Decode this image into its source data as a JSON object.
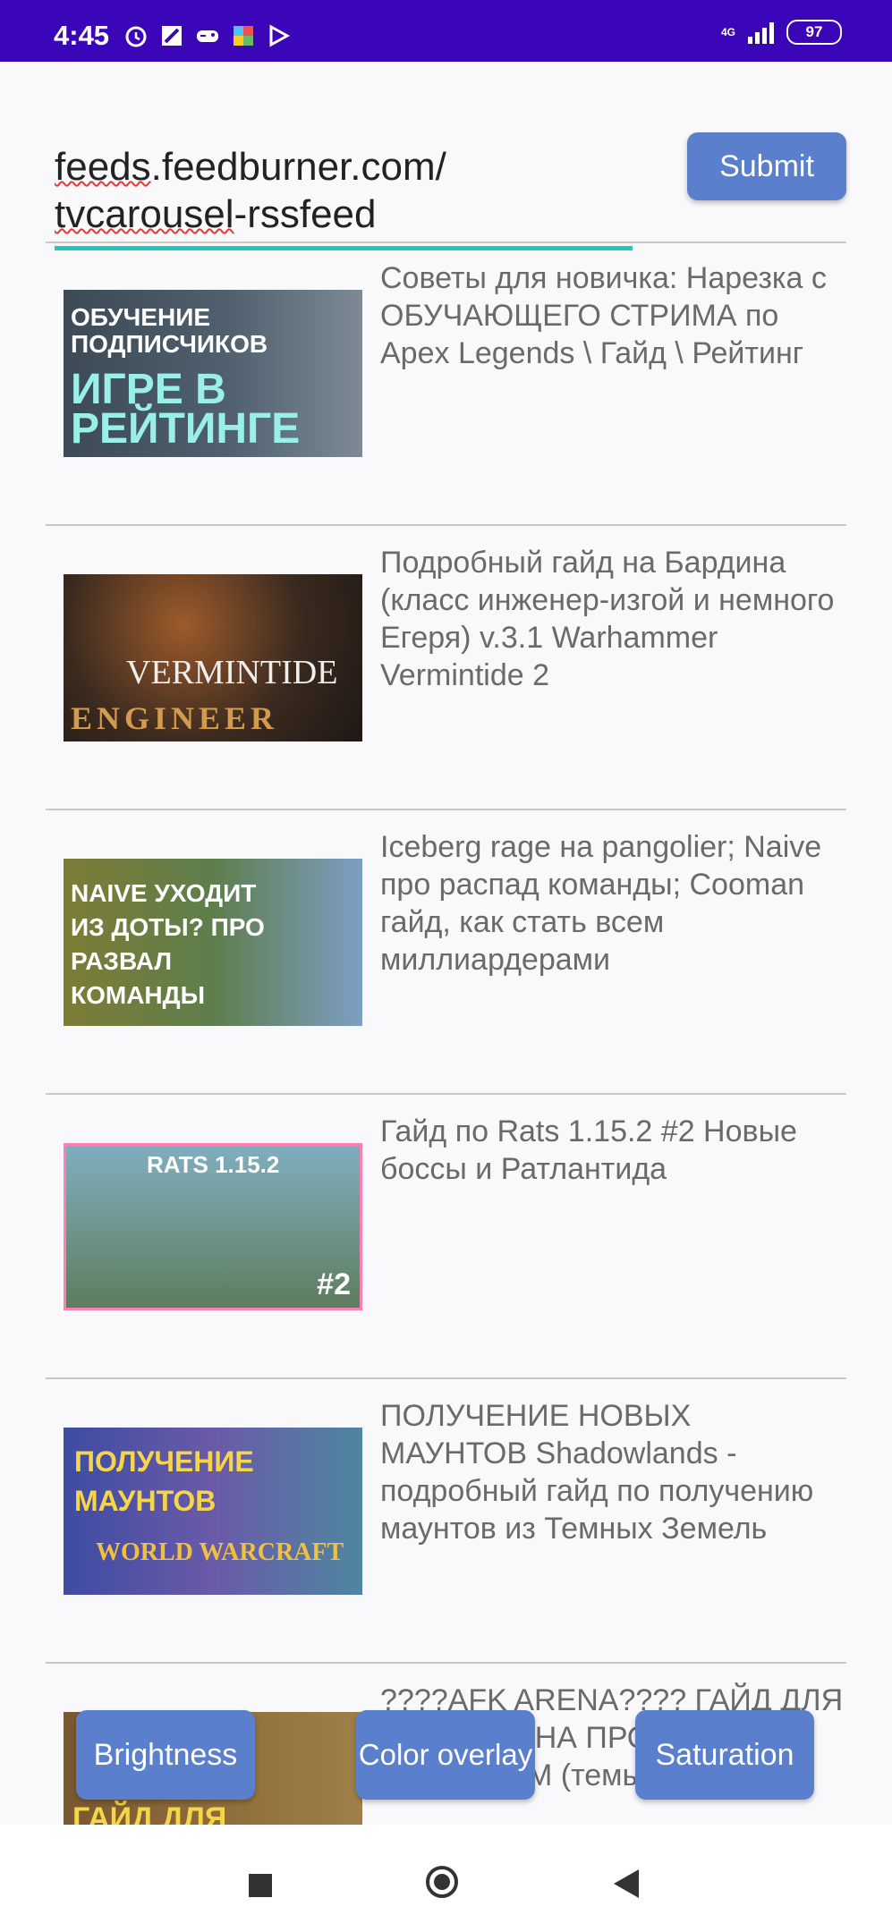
{
  "status_bar": {
    "time": "4:45",
    "network": "4G",
    "battery": "97"
  },
  "url_field": {
    "value_parts": [
      "feeds",
      ".feedburner.com/",
      "tvcarousel",
      "-rssfeed"
    ]
  },
  "submit_label": "Submit",
  "feed": [
    {
      "title": "Советы для новичка: Нарезка с ОБУЧАЮЩЕГО СТРИМА по Apex Legends \\ Гайд \\ Рейтинг"
    },
    {
      "title": "Подробный гайд на Бардина (класс инженер-изгой и немного Егеря)  v.3.1 Warhammer Vermintide 2"
    },
    {
      "title": "Iceberg rage на pangolier; Naive про распад команды; Cooman гайд, как стать всем миллиардерами"
    },
    {
      "title": "Гайд по Rats 1.15.2 #2 Новые боссы и Ратлантида"
    },
    {
      "title": "ПОЛУЧЕНИЕ НОВЫХ МАУНТОВ Shadowlands - подробный гайд по получению маунтов из Темных Земель"
    },
    {
      "title": "????AFK ARENA???? ГАЙД ДЛЯ НОВИЧКА НА ПРОБЛЕМЫ С СОСТАВОМ (темы в"
    }
  ],
  "thumbs": {
    "t1_a": "ОБУЧЕНИЕ ПОДПИСЧИКОВ",
    "t1_b": "ИГРЕ В РЕЙТИНГЕ",
    "t2_a": "VERMINTIDE",
    "t2_b": "ENGINEER",
    "t3_a": "NAIVE УХОДИТ ИЗ ДОТЫ? ПРО РАЗВАЛ КОМАНДЫ",
    "t4_a": "RATS 1.15.2",
    "t4_b": "#2",
    "t5_a": "ПОЛУЧЕНИЕ МАУНТОВ",
    "t5_b": "WORLD WARCRAFT",
    "t6_a": "ГАЙД ДЛЯ"
  },
  "buttons": {
    "brightness": "Brightness",
    "color_overlay": "Color overlay",
    "saturation": "Saturation"
  }
}
